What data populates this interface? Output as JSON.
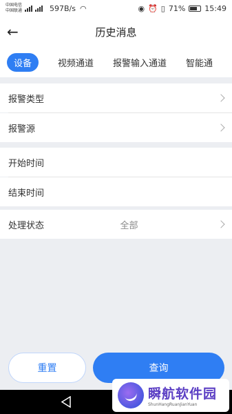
{
  "status_bar": {
    "carrier1": "中国电信",
    "carrier2": "中国联通",
    "speed": "597B/s",
    "battery": "71%",
    "time": "15:49"
  },
  "header": {
    "back_icon": "arrow-left-icon",
    "title": "历史消息"
  },
  "tabs": [
    {
      "label": "设备",
      "active": true
    },
    {
      "label": "视频通道",
      "active": false
    },
    {
      "label": "报警输入通道",
      "active": false
    },
    {
      "label": "智能通",
      "active": false
    }
  ],
  "filters": {
    "alarm_type": "报警类型",
    "alarm_source": "报警源",
    "start_time": "开始时间",
    "end_time": "结束时间",
    "process_status": "处理状态",
    "process_status_value": "全部"
  },
  "actions": {
    "reset": "重置",
    "query": "查询"
  },
  "watermark": {
    "title": "瞬航软件园",
    "subtitle": "ShunHangRuanJianYuan"
  },
  "colors": {
    "accent": "#2f7ef3",
    "background": "#eceef2"
  }
}
